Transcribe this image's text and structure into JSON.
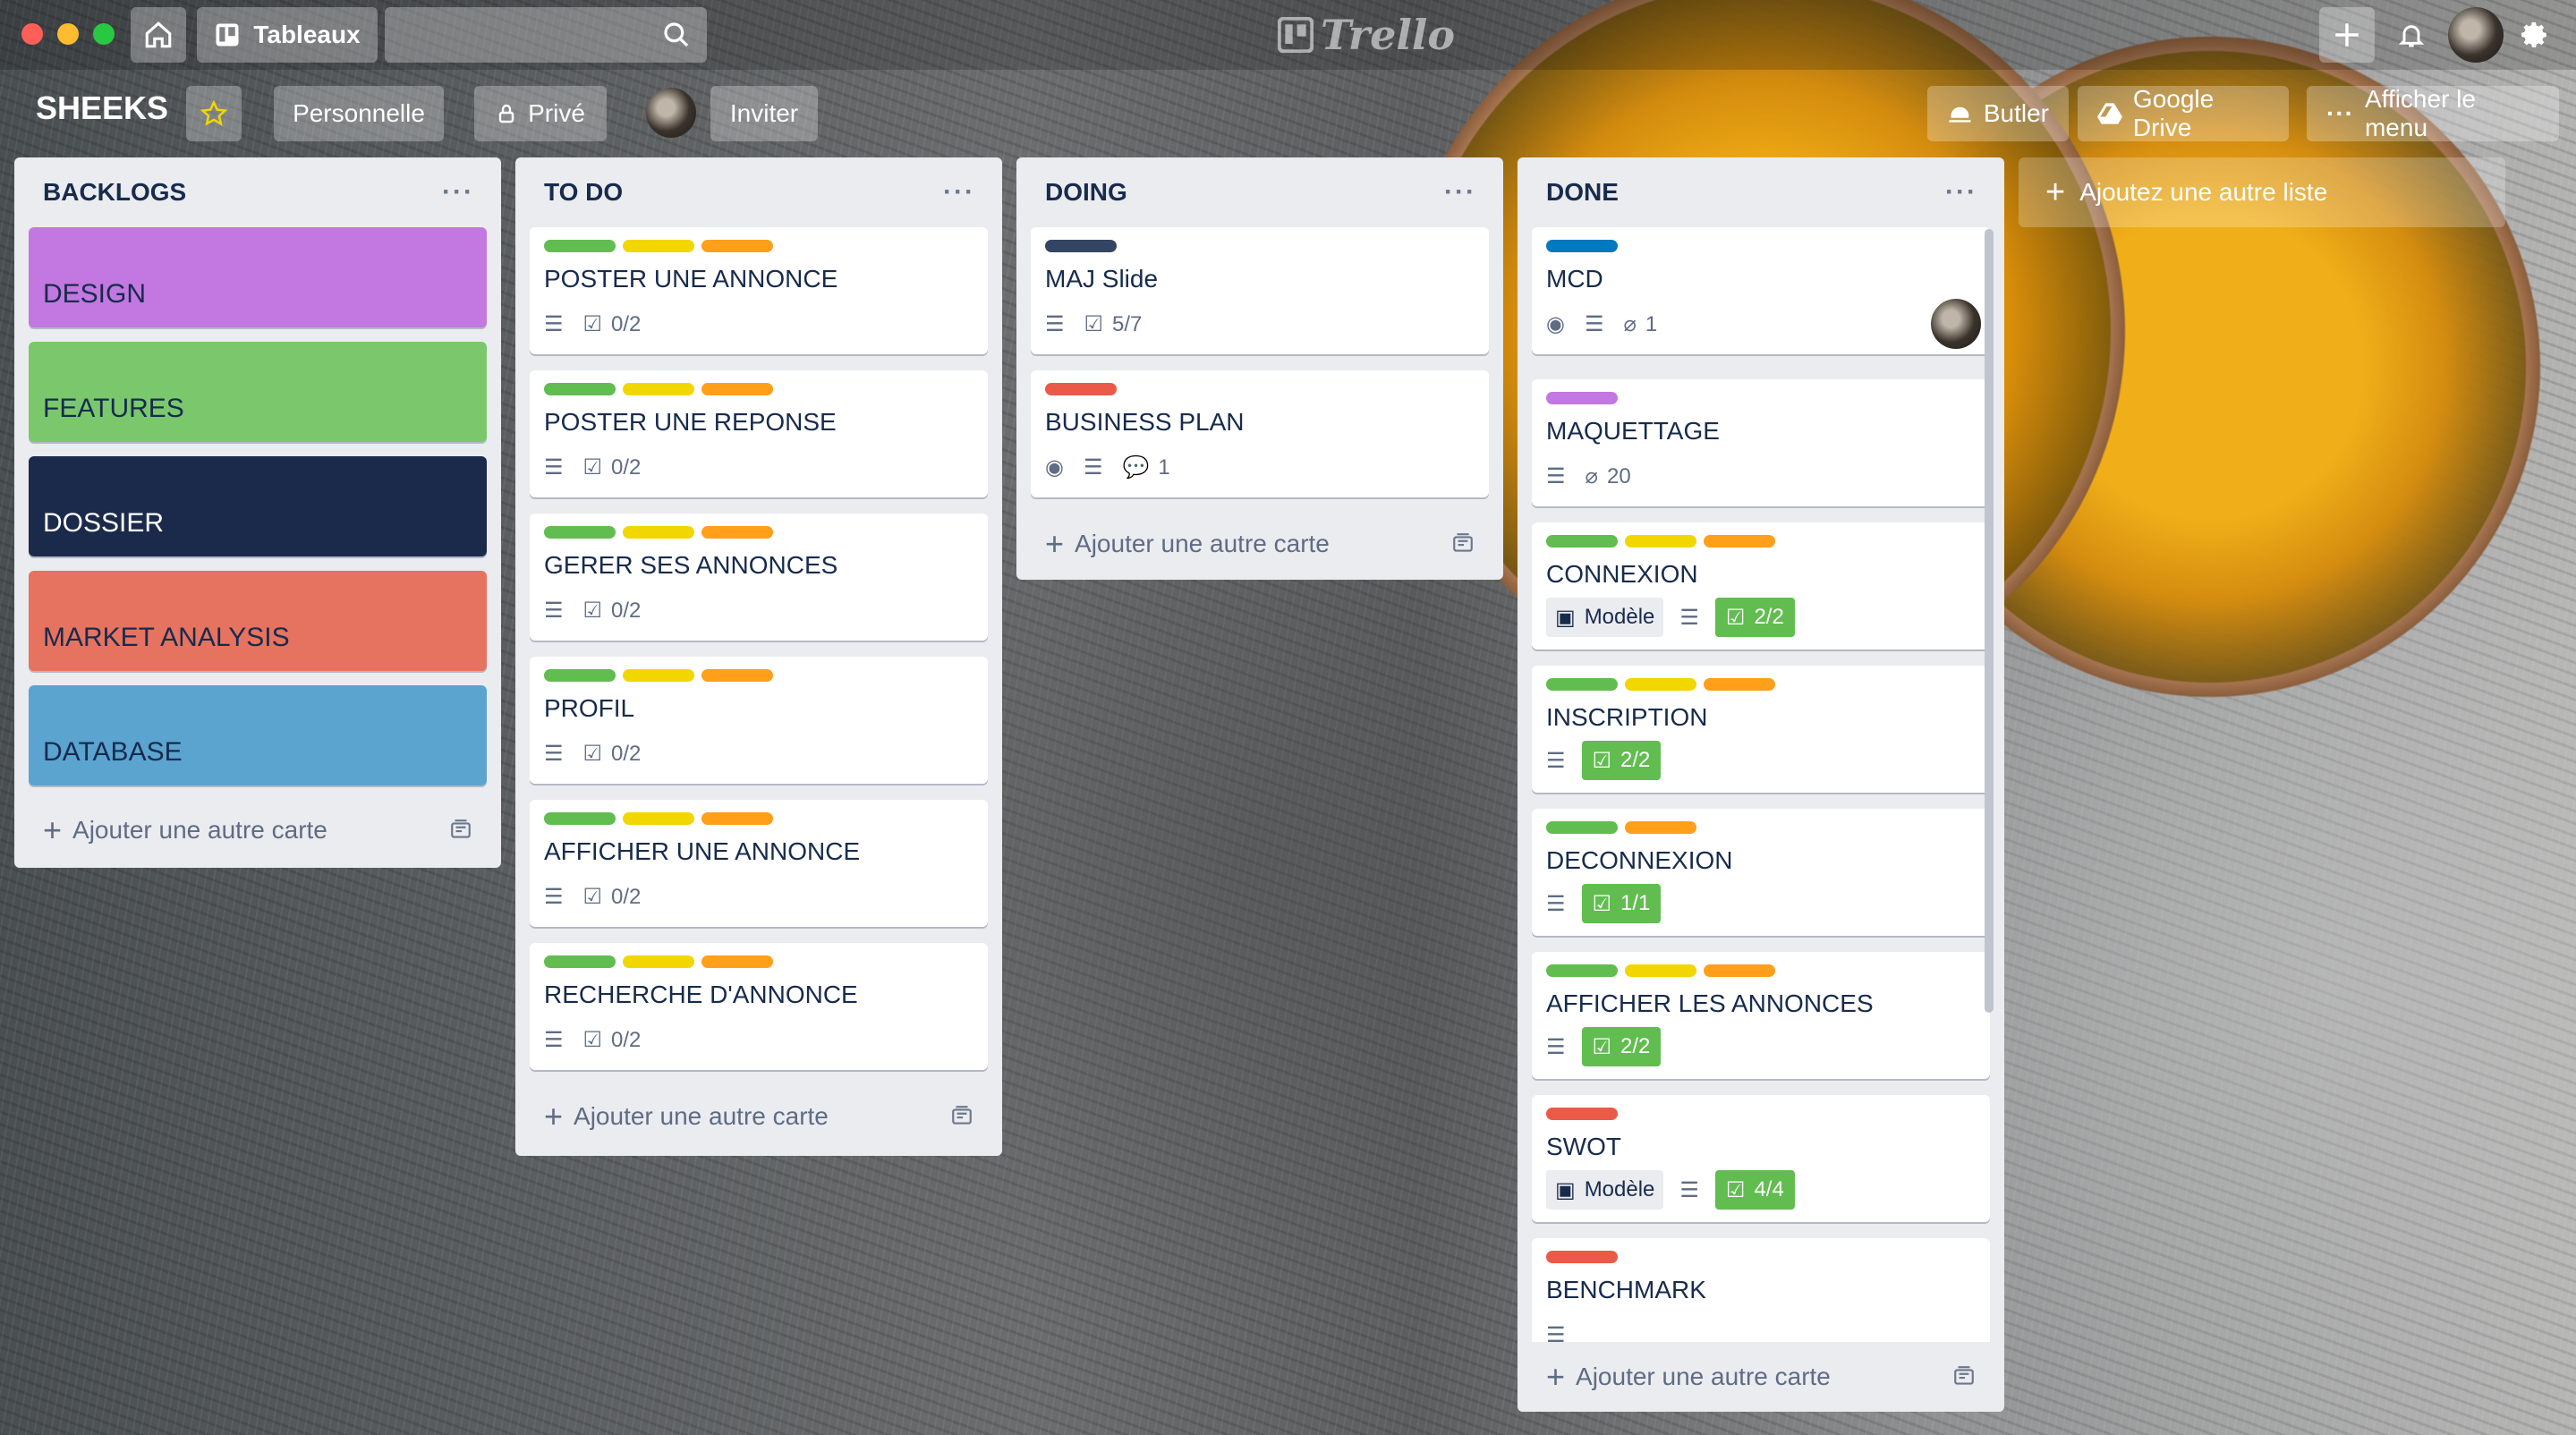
{
  "app": {
    "logo": "Trello"
  },
  "topbar": {
    "boards_label": "Tableaux"
  },
  "board": {
    "name": "SHEEKS",
    "team": "Personnelle",
    "visibility": "Privé",
    "invite": "Inviter",
    "butler": "Butler",
    "google_drive": "Google Drive",
    "menu": "Afficher le menu",
    "add_list": "Ajoutez une autre liste"
  },
  "colors": {
    "green": "#61bd4f",
    "yellow": "#f2d600",
    "orange": "#ff9f1a",
    "red": "#eb5a46",
    "purple": "#c377e0",
    "blue": "#0079bf",
    "navy": "#344563"
  },
  "lists": [
    {
      "title": "BACKLOGS",
      "add_card": "Ajouter une autre carte",
      "cards": [
        {
          "title": "DESIGN",
          "cover": "#c377e0"
        },
        {
          "title": "FEATURES",
          "cover": "#7bc86c"
        },
        {
          "title": "DOSSIER",
          "cover": "#1b2a4a"
        },
        {
          "title": "MARKET ANALYSIS",
          "cover": "#e6735f"
        },
        {
          "title": "DATABASE",
          "cover": "#5ba4cf"
        }
      ]
    },
    {
      "title": "TO DO",
      "add_card": "Ajouter une autre carte",
      "cards": [
        {
          "title": "POSTER UNE ANNONCE",
          "checklist": "0/2"
        },
        {
          "title": "POSTER UNE REPONSE",
          "checklist": "0/2"
        },
        {
          "title": "GERER SES ANNONCES",
          "checklist": "0/2"
        },
        {
          "title": "PROFIL",
          "checklist": "0/2"
        },
        {
          "title": "AFFICHER UNE ANNONCE",
          "checklist": "0/2"
        },
        {
          "title": "RECHERCHE D'ANNONCE",
          "checklist": "0/2"
        }
      ]
    },
    {
      "title": "DOING",
      "add_card": "Ajouter une autre carte",
      "cards": [
        {
          "title": "MAJ Slide",
          "checklist": "5/7"
        },
        {
          "title": "BUSINESS PLAN",
          "comments": "1"
        }
      ]
    },
    {
      "title": "DONE",
      "add_card": "Ajouter une autre carte",
      "cards": [
        {
          "title": "MCD",
          "attachments": "1"
        },
        {
          "title": "MAQUETTAGE",
          "attachments": "20"
        },
        {
          "title": "CONNEXION",
          "template": "Modèle",
          "checklist": "2/2"
        },
        {
          "title": "INSCRIPTION",
          "checklist": "2/2"
        },
        {
          "title": "DECONNEXION",
          "checklist": "1/1"
        },
        {
          "title": "AFFICHER LES ANNONCES",
          "checklist": "2/2"
        },
        {
          "title": "SWOT",
          "template": "Modèle",
          "checklist": "4/4"
        },
        {
          "title": "BENCHMARK"
        }
      ]
    }
  ]
}
